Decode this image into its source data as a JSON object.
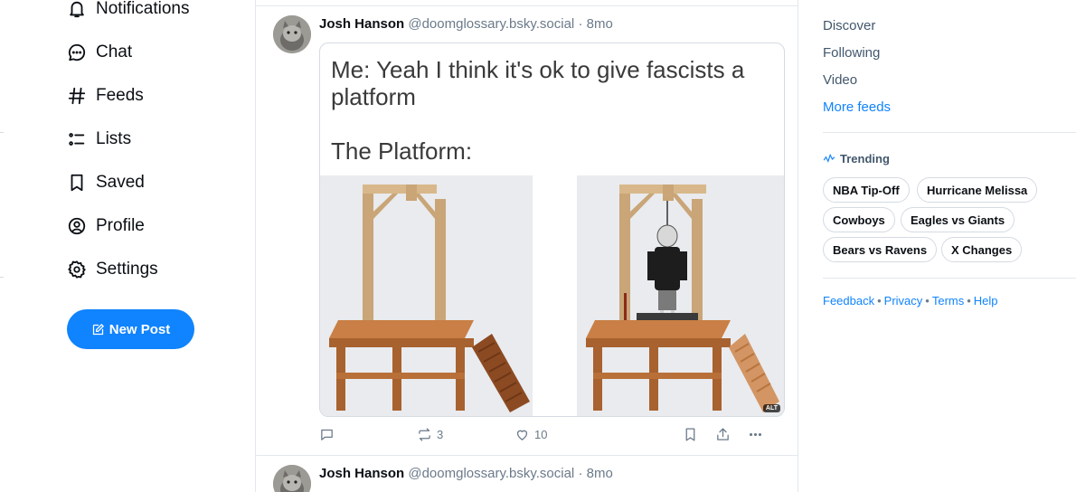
{
  "nav": {
    "items": [
      {
        "label": "Notifications",
        "icon": "bell-icon"
      },
      {
        "label": "Chat",
        "icon": "chat-icon"
      },
      {
        "label": "Feeds",
        "icon": "hash-icon"
      },
      {
        "label": "Lists",
        "icon": "list-icon"
      },
      {
        "label": "Saved",
        "icon": "bookmark-icon"
      },
      {
        "label": "Profile",
        "icon": "profile-icon"
      },
      {
        "label": "Settings",
        "icon": "gear-icon"
      }
    ],
    "new_post_label": "New Post"
  },
  "post": {
    "author": "Josh Hanson",
    "handle": "@doomglossary.bsky.social",
    "separator": "·",
    "time": "8mo",
    "image_text_line1": "Me: Yeah I think it's ok to give fascists a",
    "image_text_line2": "platform",
    "image_text_line3": "The Platform:",
    "alt_badge": "ALT",
    "reposts": "3",
    "likes": "10"
  },
  "post2": {
    "author": "Josh Hanson",
    "handle": "@doomglossary.bsky.social",
    "separator": "·",
    "time": "8mo"
  },
  "right": {
    "feeds": [
      "Discover",
      "Following",
      "Video"
    ],
    "more_feeds": "More feeds",
    "trending_title": "Trending",
    "trending": [
      "NBA Tip-Off",
      "Hurricane Melissa",
      "Cowboys",
      "Eagles vs Giants",
      "Bears vs Ravens",
      "X Changes"
    ],
    "footer": [
      "Feedback",
      "Privacy",
      "Terms",
      "Help"
    ],
    "footer_separator": "•"
  },
  "colors": {
    "accent": "#1083fe",
    "text": "#0b0f14",
    "muted": "#6b7a8a",
    "border": "#e3e8ed"
  }
}
